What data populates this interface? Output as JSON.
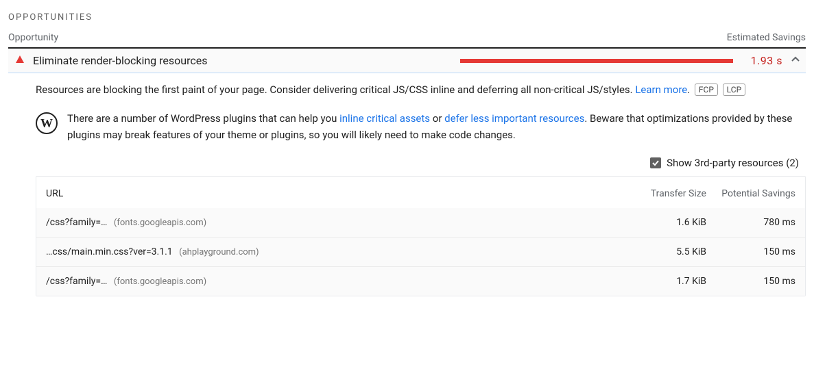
{
  "section_title": "OPPORTUNITIES",
  "columns": {
    "opportunity": "Opportunity",
    "est_savings": "Estimated Savings"
  },
  "audit": {
    "title": "Eliminate render-blocking resources",
    "savings": "1.93 s",
    "gauge_percent": 100,
    "description_before_link": "Resources are blocking the first paint of your page. Consider delivering critical JS/CSS inline and deferring all non-critical JS/styles. ",
    "learn_more": "Learn more",
    "pills": [
      "FCP",
      "LCP"
    ]
  },
  "wordpress": {
    "before_link1": "There are a number of WordPress plugins that can help you ",
    "link1": "inline critical assets",
    "middle": " or ",
    "link2": "defer less important resources",
    "after": ". Beware that optimizations provided by these plugins may break features of your theme or plugins, so you will likely need to make code changes."
  },
  "third_party": {
    "label": "Show 3rd-party resources (2)",
    "checked": true
  },
  "table": {
    "headers": {
      "url": "URL",
      "size": "Transfer Size",
      "savings": "Potential Savings"
    },
    "rows": [
      {
        "url": "/css?family=…",
        "origin": "(fonts.googleapis.com)",
        "size": "1.6 KiB",
        "savings": "780 ms"
      },
      {
        "url": "…css/main.min.css?ver=3.1.1",
        "origin": "(ahplayground.com)",
        "size": "5.5 KiB",
        "savings": "150 ms"
      },
      {
        "url": "/css?family=…",
        "origin": "(fonts.googleapis.com)",
        "size": "1.7 KiB",
        "savings": "150 ms"
      }
    ]
  }
}
